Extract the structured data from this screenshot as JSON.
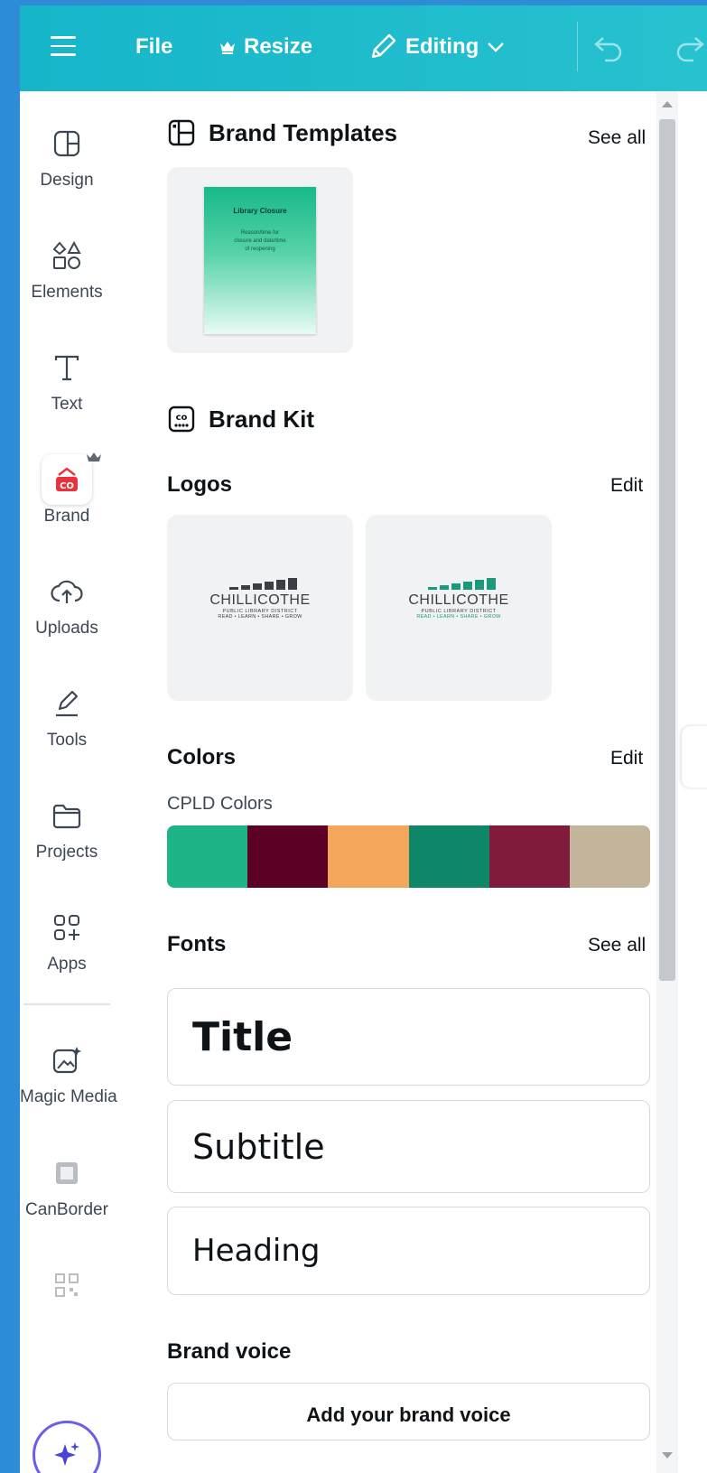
{
  "topbar": {
    "file_label": "File",
    "resize_label": "Resize",
    "editing_label": "Editing"
  },
  "rail": {
    "items": [
      {
        "label": "Design"
      },
      {
        "label": "Elements"
      },
      {
        "label": "Text"
      },
      {
        "label": "Brand",
        "badge": "CO"
      },
      {
        "label": "Uploads"
      },
      {
        "label": "Tools"
      },
      {
        "label": "Projects"
      },
      {
        "label": "Apps"
      },
      {
        "label": "Magic Media"
      },
      {
        "label": "CanBorder"
      }
    ]
  },
  "panel": {
    "brand_templates": {
      "title": "Brand Templates",
      "see_all": "See all",
      "template": {
        "heading": "Library Closure",
        "body": "Reason/time for closure and date/time of reopening"
      }
    },
    "brand_kit": {
      "title": "Brand Kit"
    },
    "logos": {
      "title": "Logos",
      "edit": "Edit",
      "items": [
        {
          "name": "CHILLICOTHE",
          "sub": "PUBLIC LIBRARY DISTRICT",
          "tagline": "READ • LEARN • SHARE • GROW",
          "color": "#3a3f45"
        },
        {
          "name": "CHILLICOTHE",
          "sub": "PUBLIC LIBRARY DISTRICT",
          "tagline": "READ • LEARN • SHARE • GROW",
          "color": "#1a9a7a"
        }
      ]
    },
    "colors": {
      "title": "Colors",
      "edit": "Edit",
      "palette_name": "CPLD Colors",
      "swatches": [
        "#1fb487",
        "#5c0025",
        "#f4a75a",
        "#0e8668",
        "#801b3c",
        "#c3b59c"
      ]
    },
    "fonts": {
      "title": "Fonts",
      "see_all": "See all",
      "title_sample": "Title",
      "subtitle_sample": "Subtitle",
      "heading_sample": "Heading"
    },
    "brand_voice": {
      "title": "Brand voice",
      "add_label": "Add your brand voice"
    }
  }
}
